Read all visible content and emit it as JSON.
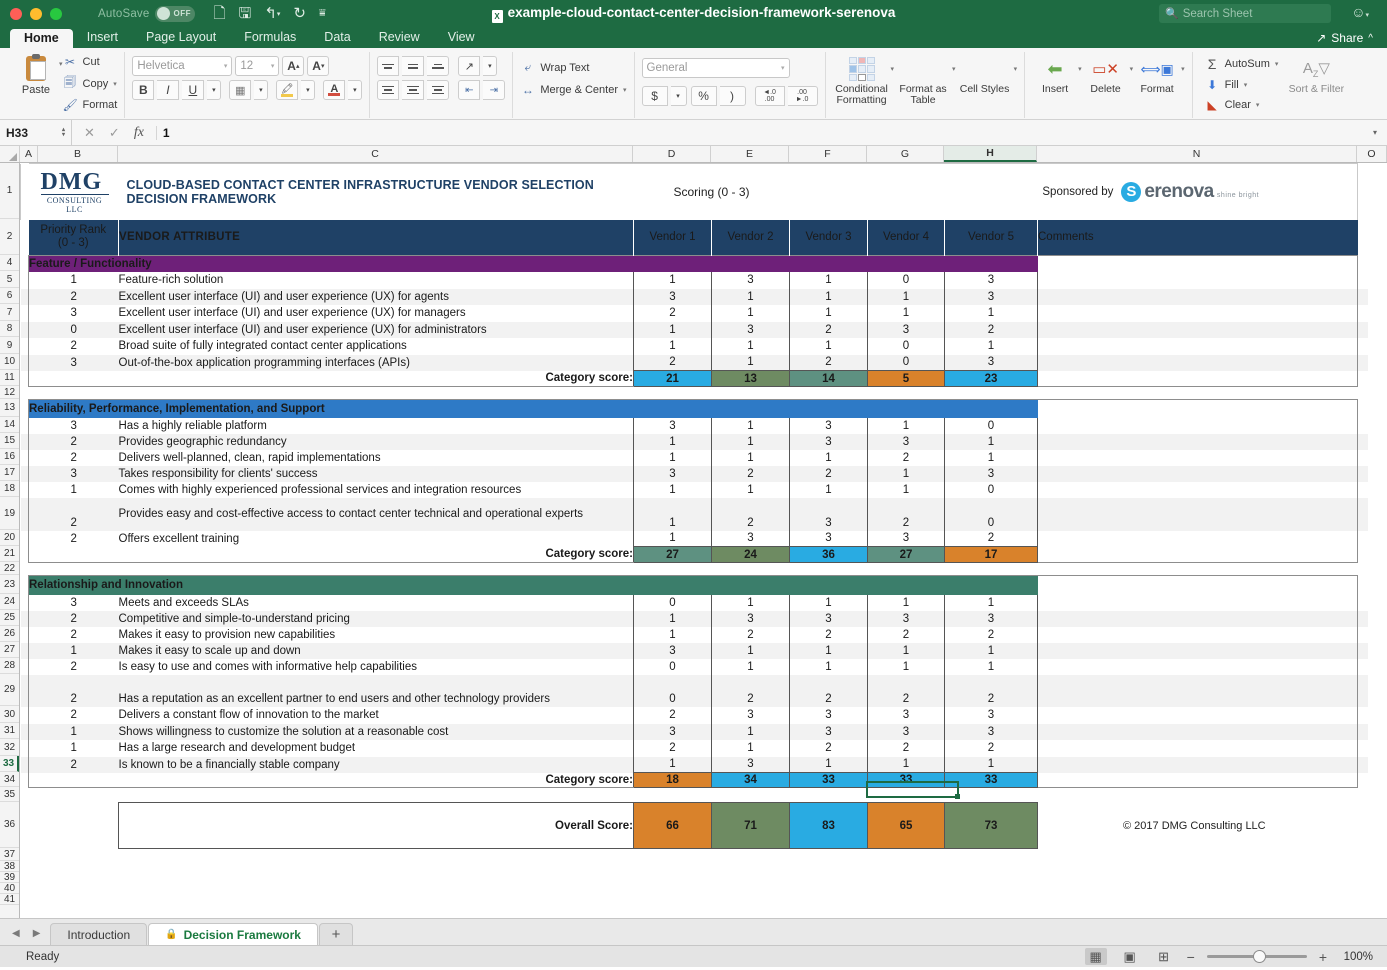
{
  "titlebar": {
    "autosave_label": "AutoSave",
    "autosave_state": "OFF",
    "document_title": "example-cloud-contact-center-decision-framework-serenova",
    "search_placeholder": "Search Sheet",
    "quick_access": [
      "new-document-icon",
      "save-icon",
      "undo-icon",
      "redo-icon",
      "customize-icon"
    ]
  },
  "ribbon_tabs": {
    "tabs": [
      "Home",
      "Insert",
      "Page Layout",
      "Formulas",
      "Data",
      "Review",
      "View"
    ],
    "active": "Home",
    "share_label": "Share"
  },
  "ribbon": {
    "clipboard": {
      "paste": "Paste",
      "cut": "Cut",
      "copy": "Copy",
      "format": "Format"
    },
    "font": {
      "family": "Helvetica",
      "size": "12",
      "grow": "A",
      "shrink": "A"
    },
    "alignment": {
      "wrap_text": "Wrap Text",
      "merge_center": "Merge & Center"
    },
    "number": {
      "format": "General",
      "currency": "$",
      "percent": "%",
      "comma": ")",
      "inc_dec": ".00",
      "dec_dec": ".00"
    },
    "styles": {
      "conditional": "Conditional Formatting",
      "table": "Format as Table",
      "cell": "Cell Styles"
    },
    "cells": {
      "insert": "Insert",
      "delete": "Delete",
      "format": "Format"
    },
    "editing": {
      "autosum": "AutoSum",
      "fill": "Fill",
      "clear": "Clear",
      "sort_filter": "Sort & Filter"
    }
  },
  "formula_bar": {
    "name_box": "H33",
    "value": "1",
    "cancel_icon": "close-icon",
    "confirm_icon": "check-icon",
    "function_icon": "fx-icon"
  },
  "grid": {
    "columns": [
      "A",
      "B",
      "C",
      "D",
      "E",
      "F",
      "G",
      "H",
      "N",
      "O"
    ],
    "selected_column": "H",
    "selected_cell": "H33",
    "rows": [
      "1",
      "2",
      "4",
      "5",
      "6",
      "7",
      "8",
      "9",
      "10",
      "11",
      "12",
      "13",
      "14",
      "15",
      "16",
      "17",
      "18",
      "19",
      "20",
      "21",
      "22",
      "23",
      "24",
      "25",
      "26",
      "27",
      "28",
      "29",
      "30",
      "31",
      "32",
      "33",
      "34",
      "35",
      "36",
      "37",
      "38",
      "39",
      "40",
      "41"
    ],
    "selected_row": "33"
  },
  "sheet_header": {
    "logo_main": "DMG",
    "logo_sub": "CONSULTING LLC",
    "title": "CLOUD-BASED CONTACT CENTER INFRASTRUCTURE VENDOR SELECTION DECISION FRAMEWORK",
    "scoring_label": "Scoring (0 - 3)",
    "sponsored_by": "Sponsored by",
    "sponsor_name": "erenova",
    "sponsor_badge": "S",
    "sponsor_tagline": "shine bright"
  },
  "table_header": {
    "priority_rank_line1": "Priority Rank",
    "priority_rank_line2": "(0 - 3)",
    "attribute": "VENDOR ATTRIBUTE",
    "vendors": [
      "Vendor 1",
      "Vendor 2",
      "Vendor 3",
      "Vendor 4",
      "Vendor 5"
    ],
    "comments": "Comments"
  },
  "category_score_label": "Category score:",
  "overall_score_label": "Overall Score:",
  "copyright": "© 2017 DMG Consulting LLC",
  "sections": [
    {
      "name": "Feature / Functionality",
      "color": "#6e2079",
      "rows": [
        {
          "rank": "1",
          "attribute": "Feature-rich solution",
          "scores": [
            "1",
            "3",
            "1",
            "0",
            "3"
          ]
        },
        {
          "rank": "2",
          "attribute": "Excellent user interface (UI) and user experience (UX) for agents",
          "scores": [
            "3",
            "1",
            "1",
            "1",
            "3"
          ]
        },
        {
          "rank": "3",
          "attribute": "Excellent user interface (UI) and user experience (UX) for managers",
          "scores": [
            "2",
            "1",
            "1",
            "1",
            "1"
          ]
        },
        {
          "rank": "0",
          "attribute": "Excellent user interface (UI) and user experience (UX) for administrators",
          "scores": [
            "1",
            "3",
            "2",
            "3",
            "2"
          ]
        },
        {
          "rank": "2",
          "attribute": "Broad suite of fully integrated contact center applications",
          "scores": [
            "1",
            "1",
            "1",
            "0",
            "1"
          ]
        },
        {
          "rank": "3",
          "attribute": "Out-of-the-box application programming interfaces (APIs)",
          "scores": [
            "2",
            "1",
            "2",
            "0",
            "3"
          ]
        }
      ],
      "category_scores": [
        "21",
        "13",
        "14",
        "5",
        "23"
      ],
      "category_colors": [
        "#29abe2",
        "#6e8b62",
        "#5e9181",
        "#d9822b",
        "#29abe2"
      ]
    },
    {
      "name": "Reliability, Performance, Implementation, and Support",
      "color": "#2e7ac6",
      "rows": [
        {
          "rank": "3",
          "attribute": "Has a highly reliable platform",
          "scores": [
            "3",
            "1",
            "3",
            "1",
            "0"
          ]
        },
        {
          "rank": "2",
          "attribute": "Provides geographic redundancy",
          "scores": [
            "1",
            "1",
            "3",
            "3",
            "1"
          ]
        },
        {
          "rank": "2",
          "attribute": "Delivers well-planned, clean, rapid implementations",
          "scores": [
            "1",
            "1",
            "1",
            "2",
            "1"
          ]
        },
        {
          "rank": "3",
          "attribute": "Takes responsibility for clients' success",
          "scores": [
            "3",
            "2",
            "2",
            "1",
            "3"
          ]
        },
        {
          "rank": "1",
          "attribute": "Comes with highly experienced professional services and integration resources",
          "scores": [
            "1",
            "1",
            "1",
            "1",
            "0"
          ]
        },
        {
          "rank": "2",
          "attribute": "Provides easy and cost-effective access to contact center technical and operational experts",
          "scores": [
            "1",
            "2",
            "3",
            "2",
            "0"
          ]
        },
        {
          "rank": "2",
          "attribute": "Offers excellent training",
          "scores": [
            "1",
            "3",
            "3",
            "3",
            "2"
          ]
        }
      ],
      "category_scores": [
        "27",
        "24",
        "36",
        "27",
        "17"
      ],
      "category_colors": [
        "#5e9181",
        "#6e8b62",
        "#29abe2",
        "#5e9181",
        "#d9822b"
      ]
    },
    {
      "name": "Relationship and Innovation",
      "color": "#3b7e6b",
      "rows": [
        {
          "rank": "3",
          "attribute": "Meets and exceeds SLAs",
          "scores": [
            "0",
            "1",
            "1",
            "1",
            "1"
          ]
        },
        {
          "rank": "2",
          "attribute": "Competitive and simple-to-understand pricing",
          "scores": [
            "1",
            "3",
            "3",
            "3",
            "3"
          ]
        },
        {
          "rank": "2",
          "attribute": "Makes it easy to provision new capabilities",
          "scores": [
            "1",
            "2",
            "2",
            "2",
            "2"
          ]
        },
        {
          "rank": "1",
          "attribute": "Makes it easy to scale up and down",
          "scores": [
            "3",
            "1",
            "1",
            "1",
            "1"
          ]
        },
        {
          "rank": "2",
          "attribute": "Is easy to use and comes with informative help capabilities",
          "scores": [
            "0",
            "1",
            "1",
            "1",
            "1"
          ]
        },
        {
          "rank": "2",
          "attribute": "Has a reputation as an excellent partner to end users and other technology providers",
          "scores": [
            "0",
            "2",
            "2",
            "2",
            "2"
          ]
        },
        {
          "rank": "2",
          "attribute": "Delivers a constant flow of innovation to the market",
          "scores": [
            "2",
            "3",
            "3",
            "3",
            "3"
          ]
        },
        {
          "rank": "1",
          "attribute": "Shows willingness to customize the solution at a reasonable cost",
          "scores": [
            "3",
            "1",
            "3",
            "3",
            "3"
          ]
        },
        {
          "rank": "1",
          "attribute": "Has a large research and development budget",
          "scores": [
            "2",
            "1",
            "2",
            "2",
            "2"
          ]
        },
        {
          "rank": "2",
          "attribute": "Is known to be a financially stable company",
          "scores": [
            "1",
            "3",
            "1",
            "1",
            "1"
          ]
        }
      ],
      "category_scores": [
        "18",
        "34",
        "33",
        "33",
        "33"
      ],
      "category_colors": [
        "#d9822b",
        "#29abe2",
        "#29abe2",
        "#29abe2",
        "#29abe2"
      ]
    }
  ],
  "overall": {
    "scores": [
      "66",
      "71",
      "83",
      "65",
      "73"
    ],
    "colors": [
      "#d9822b",
      "#6e8b62",
      "#29abe2",
      "#d9822b",
      "#6e8b62"
    ]
  },
  "sheet_tabs": {
    "tabs": [
      {
        "label": "Introduction",
        "active": false,
        "locked": false
      },
      {
        "label": "Decision Framework",
        "active": true,
        "locked": true
      }
    ],
    "add_label": "+"
  },
  "status_bar": {
    "status": "Ready",
    "zoom": "100%",
    "views": [
      "normal-view-icon",
      "page-layout-icon",
      "page-break-icon"
    ]
  }
}
